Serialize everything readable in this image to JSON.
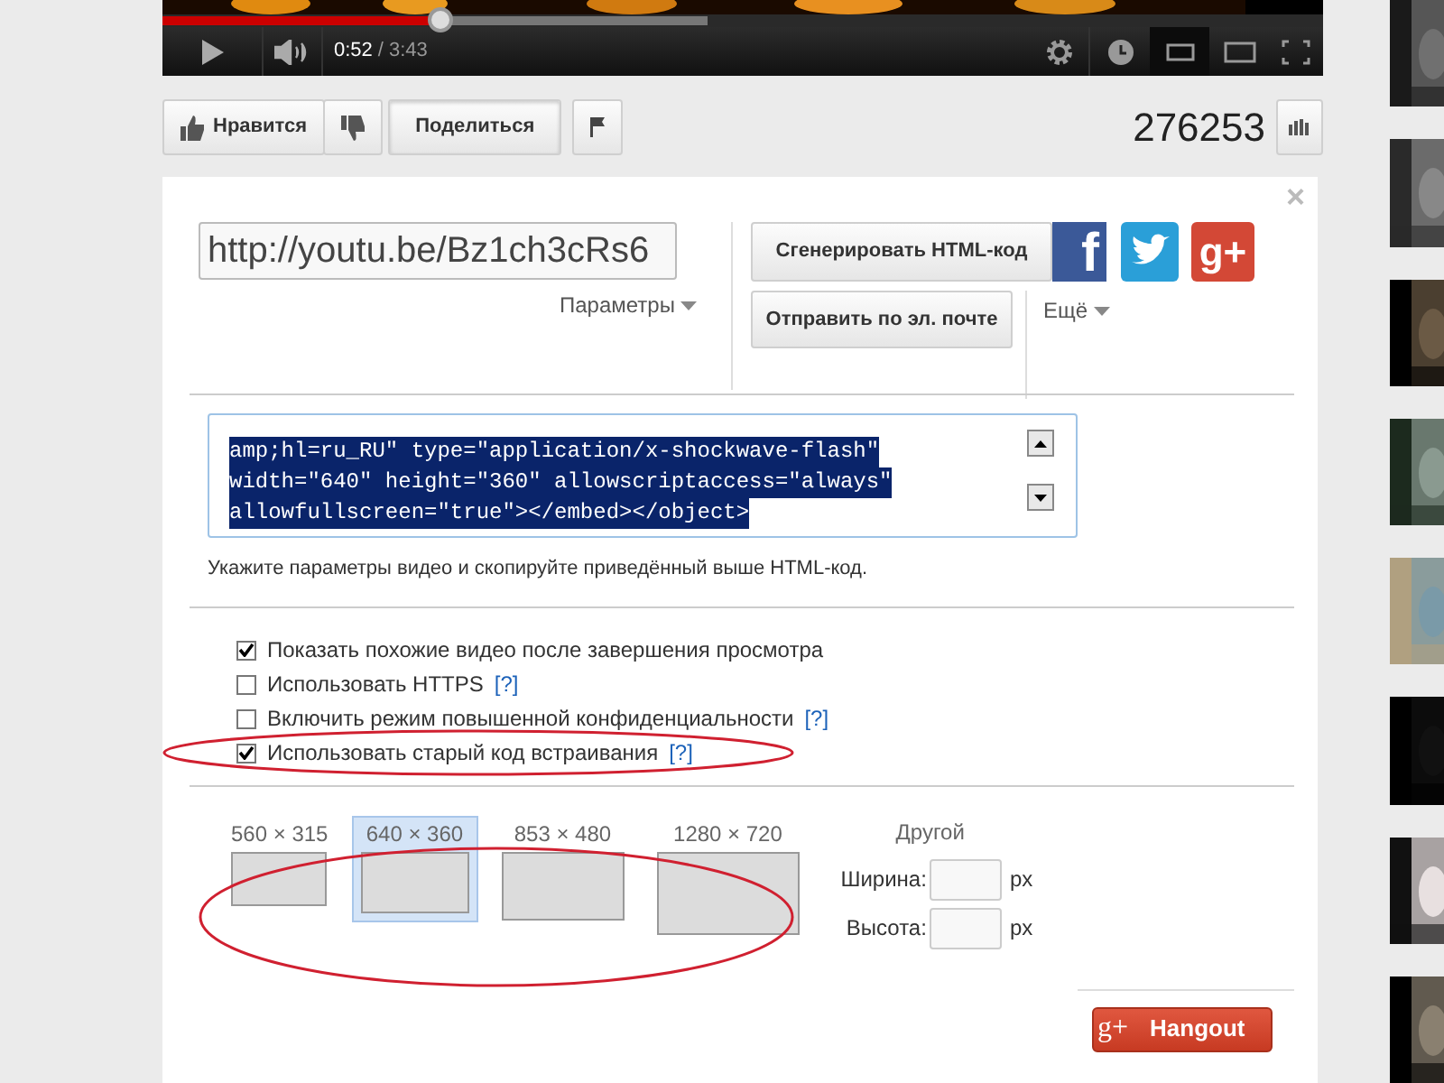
{
  "player": {
    "played": {
      "level": 0.24
    },
    "buffered": {
      "level": 0.47
    },
    "elapsed": "0:52",
    "separator": "/",
    "duration": "3:43"
  },
  "actions": [
    {
      "kind": "like",
      "label": "Нравится",
      "selected": false
    },
    {
      "kind": "dislike",
      "selected": false
    },
    {
      "kind": "share",
      "label": "Поделиться",
      "selected": true
    },
    {
      "kind": "flag",
      "selected": false
    }
  ],
  "view_count": "276253",
  "share": {
    "close": "×",
    "url": "http://youtu.be/Bz1ch3cRs6",
    "options_link": "Параметры",
    "generate_button": "Сгенерировать HTML-код",
    "email_button": "Отправить по эл. почте",
    "more_link": "Ещё",
    "social": [
      {
        "kind": "facebook",
        "glyph": "f"
      },
      {
        "kind": "twitter"
      },
      {
        "kind": "googleplus",
        "glyph": "g+"
      }
    ]
  },
  "embed": {
    "code_lines": [
      "amp;hl=ru_RU\" type=\"application/x-shockwave-flash\"",
      "width=\"640\" height=\"360\" allowscriptaccess=\"always\"",
      "allowfullscreen=\"true\"></embed></object>"
    ],
    "hint": "Укажите параметры видео и скопируйте приведённый выше HTML-код."
  },
  "options": [
    {
      "label": "Показать похожие видео после завершения просмотра",
      "checked": true
    },
    {
      "label": "Использовать HTTPS",
      "help": "[?]",
      "checked": false
    },
    {
      "label": "Включить режим повышенной конфиденциальности",
      "help": "[?]",
      "checked": false
    },
    {
      "label": "Использовать старый код встраивания",
      "help": "[?]",
      "checked": true
    }
  ],
  "sizes": [
    {
      "label": "560 × 315",
      "selected": false
    },
    {
      "label": "640 × 360",
      "selected": true
    },
    {
      "label": "853 × 480",
      "selected": false
    },
    {
      "label": "1280 × 720",
      "selected": false
    }
  ],
  "custom": {
    "title": "Другой",
    "width_label": "Ширина:",
    "width_unit": "px",
    "height_label": "Высота:",
    "height_unit": "px"
  },
  "hangout": {
    "glyph": "g+",
    "label": "Hangout"
  }
}
